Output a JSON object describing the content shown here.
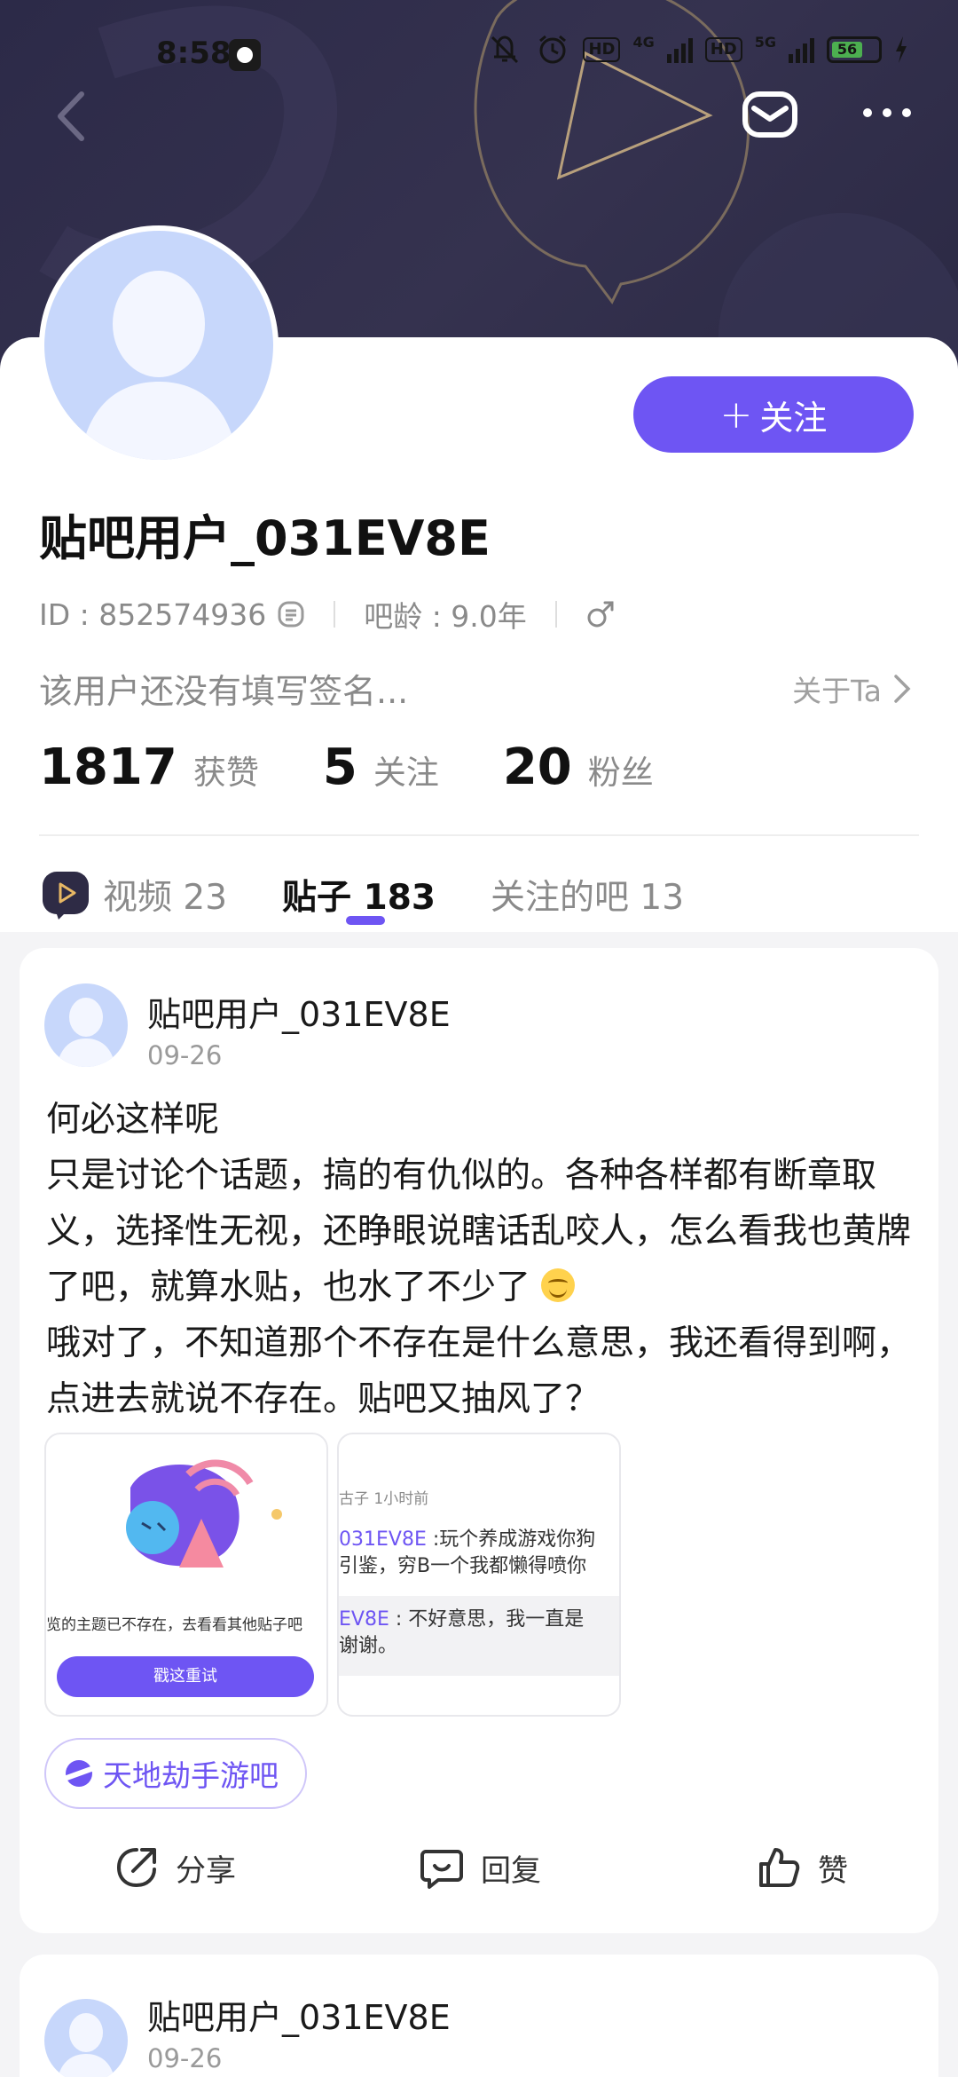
{
  "status_bar": {
    "time": "8:58",
    "network_4g": "4G",
    "network_5g": "5G",
    "hd1": "HD",
    "hd2": "HD",
    "battery": "56"
  },
  "header": {
    "back_icon": "chevron-left-icon",
    "mail_icon": "mail-icon",
    "more_icon": "more-icon"
  },
  "profile": {
    "follow_plus": "+",
    "follow_label": "关注",
    "username": "贴吧用户_031EV8E",
    "id_label": "ID : 852574936",
    "age_label": "吧龄 : 9.0年",
    "signature": "该用户还没有填写签名...",
    "about_label": "关于Ta",
    "stats": [
      {
        "num": "1817",
        "label": "获赞"
      },
      {
        "num": "5",
        "label": "关注"
      },
      {
        "num": "20",
        "label": "粉丝"
      }
    ]
  },
  "tabs": [
    {
      "label": "视频 23"
    },
    {
      "label": "贴子 183"
    },
    {
      "label": "关注的吧 13"
    }
  ],
  "posts": [
    {
      "author": "贴吧用户_031EV8E",
      "date": "09-26",
      "title_line": "何必这样呢",
      "body_part1": "只是讨论个话题，搞的有仇似的。各种各样都有断章取义，选择性无视，还睁眼说瞎话乱咬人，怎么看我也黄牌了吧，就算水贴，也水了不少了",
      "body_part2": "哦对了，不知道那个不存在是什么意思，我还看得到啊，点进去就说不存在。贴吧又抽风了？",
      "thumb1_text": "览的主题已不存在，去看看其他贴子吧",
      "thumb1_button": "戳这重试",
      "thumb2_meta": "古子  1小时前",
      "thumb2_line1_hl": "031EV8E",
      "thumb2_line1": " :玩个养成游戏你狗",
      "thumb2_line2": "引鉴，穷B一个我都懒得喷你",
      "thumb2_line3_hl": "EV8E",
      "thumb2_line3": " : 不好意思，我一直是",
      "thumb2_line4": "谢谢。",
      "forum": "天地劫手游吧",
      "actions": {
        "share": "分享",
        "reply": "回复",
        "like": "赞"
      }
    },
    {
      "author": "贴吧用户_031EV8E",
      "date": "09-26"
    }
  ],
  "colors": {
    "accent": "#6e55f3",
    "banner": "#2f2d4a",
    "avatar_bg": "#c7d7fb"
  }
}
